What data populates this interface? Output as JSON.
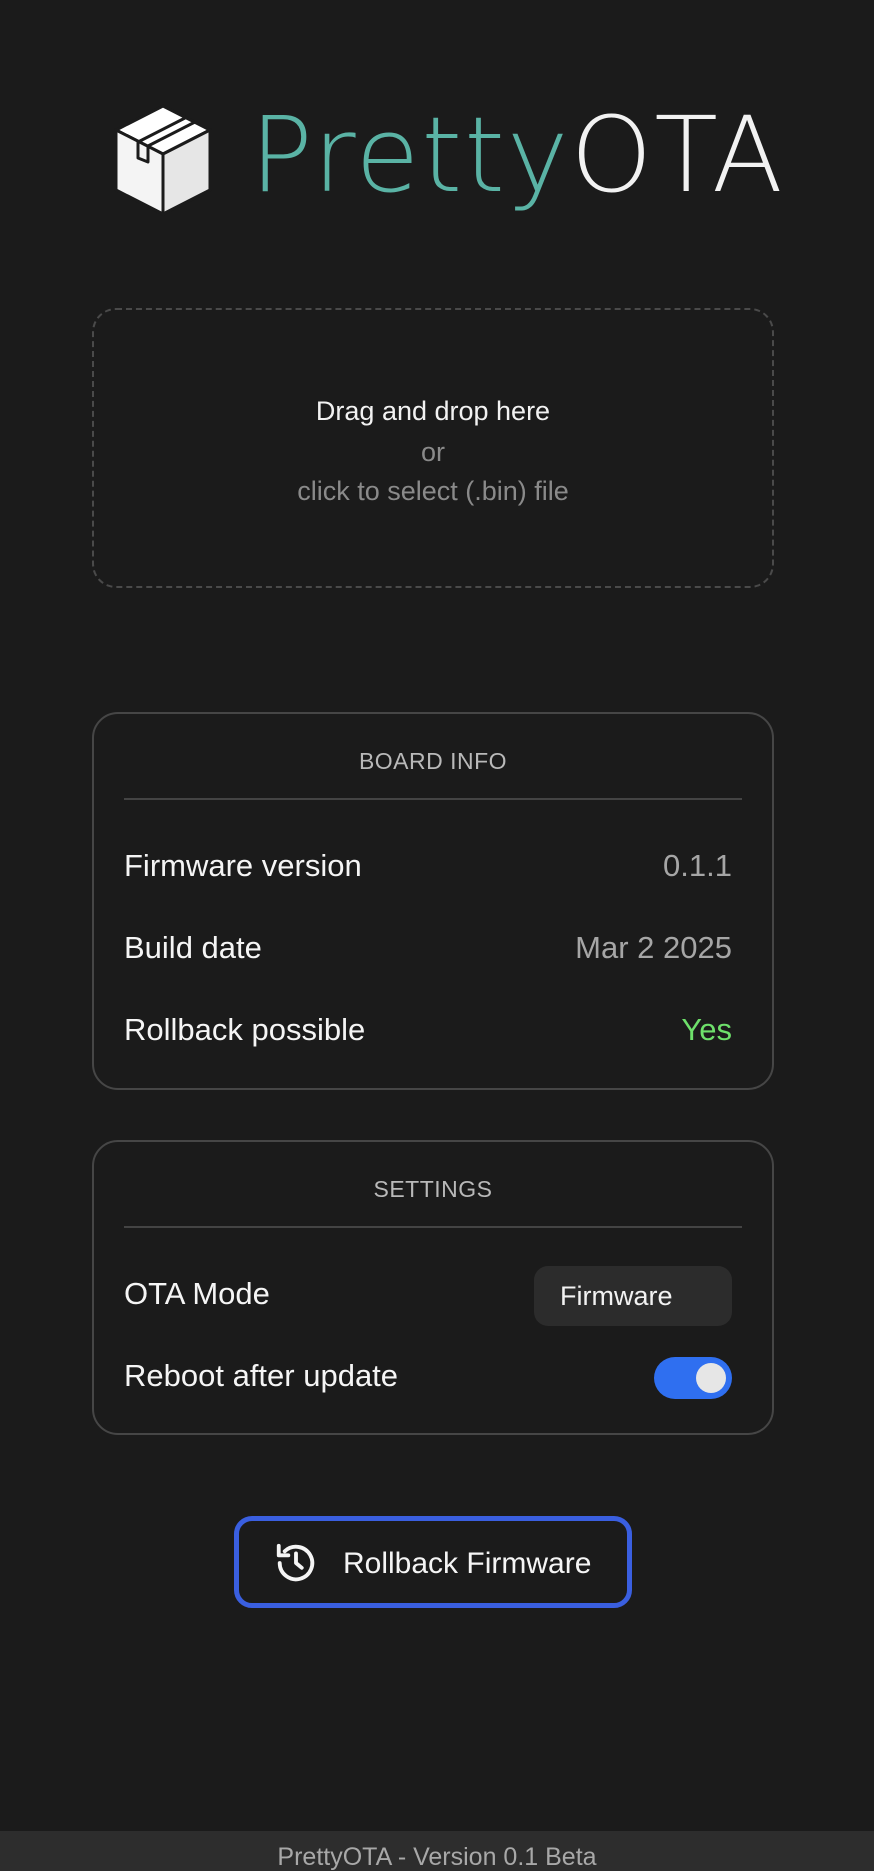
{
  "logo": {
    "pretty": "Pretty",
    "ota": "OTA",
    "icon": "package-box-icon",
    "colors": {
      "pretty": "#5ab3a5",
      "ota": "#f2f2f2"
    }
  },
  "dropzone": {
    "title": "Drag and drop here",
    "or": "or",
    "subtitle": "click to select (.bin) file"
  },
  "board_info": {
    "title": "BOARD INFO",
    "rows": [
      {
        "label": "Firmware version",
        "value": "0.1.1"
      },
      {
        "label": "Build date",
        "value": "Mar 2 2025"
      },
      {
        "label": "Rollback possible",
        "value": "Yes"
      }
    ]
  },
  "settings": {
    "title": "SETTINGS",
    "ota_mode": {
      "label": "OTA Mode",
      "selected": "Firmware"
    },
    "reboot": {
      "label": "Reboot after update",
      "enabled": true
    }
  },
  "rollback_button": {
    "label": "Rollback Firmware",
    "icon": "history-icon",
    "color": "#3a5fe0"
  },
  "footer": {
    "text": "PrettyOTA - Version 0.1 Beta"
  },
  "colors": {
    "background": "#1b1b1b",
    "accent": "#2f6ff0",
    "success": "#6ee06b"
  }
}
